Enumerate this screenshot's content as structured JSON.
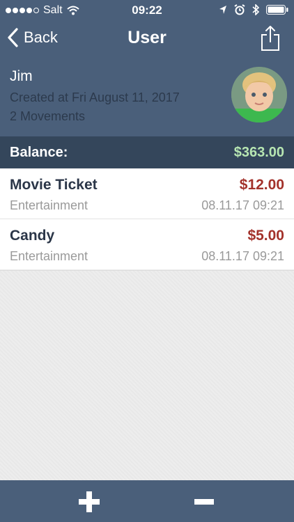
{
  "status_bar": {
    "carrier": "Salt",
    "time": "09:22"
  },
  "navbar": {
    "back_label": "Back",
    "title": "User"
  },
  "user": {
    "name": "Jim",
    "created": "Created at Fri August 11, 2017",
    "movements": "2 Movements"
  },
  "balance": {
    "label": "Balance:",
    "value": "$363.00"
  },
  "movements": [
    {
      "title": "Movie Ticket",
      "amount": "$12.00",
      "category": "Entertainment",
      "date": "08.11.17 09:21"
    },
    {
      "title": "Candy",
      "amount": "$5.00",
      "category": "Entertainment",
      "date": "08.11.17 09:21"
    }
  ],
  "colors": {
    "header": "#4a5f7a",
    "balance_bar": "#34465b",
    "balance_value": "#b7e6b2",
    "amount": "#a3322b"
  },
  "icons": {
    "back": "chevron-left-icon",
    "share": "share-icon",
    "add": "plus-icon",
    "remove": "minus-icon"
  }
}
